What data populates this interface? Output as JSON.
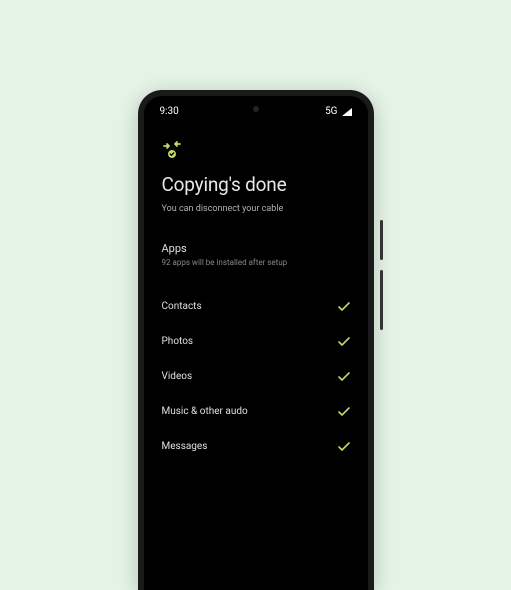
{
  "status_bar": {
    "time": "9:30",
    "network": "5G"
  },
  "screen": {
    "title": "Copying's done",
    "subtitle": "You can disconnect your cable",
    "apps_header": "Apps",
    "apps_sub": "92 apps will be installed after setup",
    "items": [
      {
        "label": "Contacts",
        "done": true
      },
      {
        "label": "Photos",
        "done": true
      },
      {
        "label": "Videos",
        "done": true
      },
      {
        "label": "Music & other audo",
        "done": true
      },
      {
        "label": "Messages",
        "done": true
      }
    ]
  },
  "colors": {
    "accent": "#bfd962",
    "bg": "#e4f3e6",
    "phone_bg": "#000000"
  }
}
